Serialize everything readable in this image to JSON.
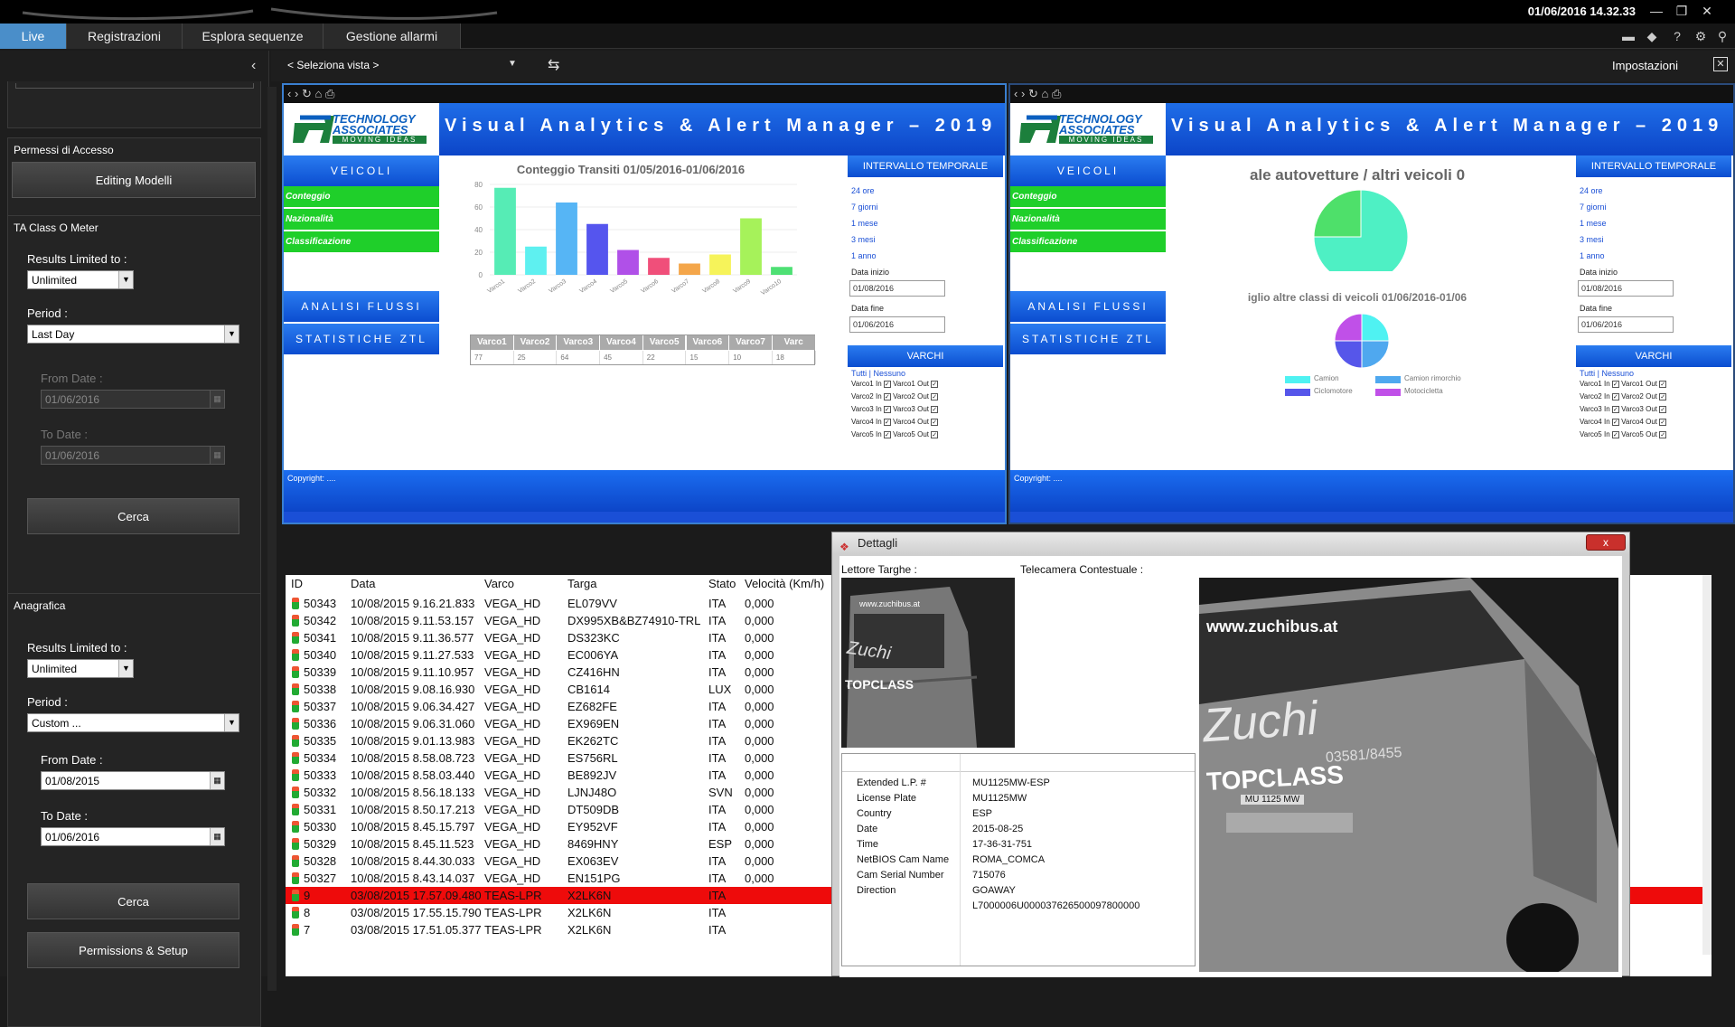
{
  "clock": "01/06/2016 14.32.33",
  "tabs": [
    "Live",
    "Registrazioni",
    "Esplora sequenze",
    "Gestione allarmi"
  ],
  "view_select": "< Seleziona vista >",
  "settings_label": "Impostazioni",
  "sidebar": {
    "access_title": "Permessi di Accesso",
    "editing_btn": "Editing Modelli",
    "meter_title": "TA Class O Meter",
    "results_label": "Results Limited to :",
    "results_value": "Unlimited",
    "period_label": "Period :",
    "period_value": "Last Day",
    "from_label": "From Date :",
    "from_value": "01/06/2016",
    "to_label": "To Date :",
    "to_value": "01/06/2016",
    "search_btn": "Cerca",
    "registry_title": "Anagrafica",
    "results2_label": "Results Limited to :",
    "results2_value": "Unlimited",
    "period2_label": "Period :",
    "period2_value": "Custom ...",
    "from2_label": "From Date :",
    "from2_value": "01/08/2015",
    "to2_label": "To Date :",
    "to2_value": "01/06/2016",
    "search2_btn": "Cerca",
    "perm_btn": "Permissions & Setup"
  },
  "web": {
    "header": "Visual Analytics & Alert Manager – 2019",
    "logo_line1": "TECHNOLOGY",
    "logo_line2": "ASSOCIATES",
    "logo_line3": "MOVING IDEAS",
    "btn_veicoli": "VEICOLI",
    "g1": "Conteggio",
    "g2": "Nazionalità",
    "g3": "Classificazione",
    "btn_flussi": "ANALISI FLUSSI",
    "btn_ztl": "STATISTICHE ZTL",
    "interval": "INTERVALLO TEMPORALE",
    "links": [
      "24 ore",
      "7 giorni",
      "1 mese",
      "3 mesi",
      "1 anno"
    ],
    "start_label": "Data inizio",
    "start_value": "01/08/2016",
    "end_label": "Data fine",
    "end_value": "01/06/2016",
    "varchi": "VARCHI",
    "tutti": "Tutti | Nessuno",
    "gates": [
      "Varco1",
      "Varco2",
      "Varco3",
      "Varco4",
      "Varco5"
    ],
    "in": "In",
    "out": "Out",
    "copyright": "Copyright: ....",
    "pane2_title1": "ale autovetture / altri veicoli 0",
    "pane2_title2": "iglio altre classi di veicoli 01/06/2016-01/06",
    "legend": [
      "Camion",
      "Camion rimorchio",
      "Ciclomotore",
      "Motocicletta"
    ]
  },
  "chart_data": [
    {
      "type": "bar",
      "title": "Conteggio Transiti 01/05/2016-01/06/2016",
      "categories": [
        "Varco1",
        "Varco2",
        "Varco3",
        "Varco4",
        "Varco5",
        "Varco6",
        "Varco7",
        "Varco8",
        "Varco9",
        "Varco10"
      ],
      "values": [
        77,
        25,
        64,
        45,
        22,
        15,
        10,
        18,
        50,
        7
      ],
      "ylim": [
        0,
        80
      ],
      "yticks": [
        0,
        20,
        40,
        60,
        80
      ],
      "colors": [
        "#56ecb5",
        "#5ef0f0",
        "#56b5f5",
        "#5555ee",
        "#b050e8",
        "#f04f7a",
        "#f4a64a",
        "#f6f35a",
        "#a6f25a",
        "#4ee074"
      ]
    },
    {
      "type": "table",
      "headers": [
        "Varco1",
        "Varco2",
        "Varco3",
        "Varco4",
        "Varco5",
        "Varco6",
        "Varco7",
        "Varc"
      ],
      "values": [
        "77",
        "25",
        "64",
        "45",
        "22",
        "15",
        "10",
        "18"
      ]
    },
    {
      "type": "pie",
      "title": "ale autovetture / altri veicoli 0",
      "values": [
        75,
        25
      ],
      "colors": [
        "#4ef0c4",
        "#4ee06a"
      ]
    },
    {
      "type": "pie",
      "title": "iglio altre classi di veicoli 01/06/2016-01/06",
      "categories": [
        "Camion",
        "Camion rimorchio",
        "Ciclomotore",
        "Motocicletta"
      ],
      "values": [
        25,
        25,
        25,
        25
      ],
      "colors": [
        "#4ff2f2",
        "#4fa8ef",
        "#5656ea",
        "#c050e8"
      ]
    }
  ],
  "grid": {
    "headers": [
      "ID",
      "Data",
      "Varco",
      "Targa",
      "Stato",
      "Velocità (Km/h)"
    ],
    "rows": [
      [
        "50343",
        "10/08/2015 9.16.21.833",
        "VEGA_HD",
        "EL079VV",
        "ITA",
        "0,000"
      ],
      [
        "50342",
        "10/08/2015 9.11.53.157",
        "VEGA_HD",
        "DX995XB&BZ74910-TRL",
        "ITA",
        "0,000"
      ],
      [
        "50341",
        "10/08/2015 9.11.36.577",
        "VEGA_HD",
        "DS323KC",
        "ITA",
        "0,000"
      ],
      [
        "50340",
        "10/08/2015 9.11.27.533",
        "VEGA_HD",
        "EC006YA",
        "ITA",
        "0,000"
      ],
      [
        "50339",
        "10/08/2015 9.11.10.957",
        "VEGA_HD",
        "CZ416HN",
        "ITA",
        "0,000"
      ],
      [
        "50338",
        "10/08/2015 9.08.16.930",
        "VEGA_HD",
        "CB1614",
        "LUX",
        "0,000"
      ],
      [
        "50337",
        "10/08/2015 9.06.34.427",
        "VEGA_HD",
        "EZ682FE",
        "ITA",
        "0,000"
      ],
      [
        "50336",
        "10/08/2015 9.06.31.060",
        "VEGA_HD",
        "EX969EN",
        "ITA",
        "0,000"
      ],
      [
        "50335",
        "10/08/2015 9.01.13.983",
        "VEGA_HD",
        "EK262TC",
        "ITA",
        "0,000"
      ],
      [
        "50334",
        "10/08/2015 8.58.08.723",
        "VEGA_HD",
        "ES756RL",
        "ITA",
        "0,000"
      ],
      [
        "50333",
        "10/08/2015 8.58.03.440",
        "VEGA_HD",
        "BE892JV",
        "ITA",
        "0,000"
      ],
      [
        "50332",
        "10/08/2015 8.56.18.133",
        "VEGA_HD",
        "LJNJ48O",
        "SVN",
        "0,000"
      ],
      [
        "50331",
        "10/08/2015 8.50.17.213",
        "VEGA_HD",
        "DT509DB",
        "ITA",
        "0,000"
      ],
      [
        "50330",
        "10/08/2015 8.45.15.797",
        "VEGA_HD",
        "EY952VF",
        "ITA",
        "0,000"
      ],
      [
        "50329",
        "10/08/2015 8.45.11.523",
        "VEGA_HD",
        "8469HNY",
        "ESP",
        "0,000"
      ],
      [
        "50328",
        "10/08/2015 8.44.30.033",
        "VEGA_HD",
        "EX063EV",
        "ITA",
        "0,000"
      ],
      [
        "50327",
        "10/08/2015 8.43.14.037",
        "VEGA_HD",
        "EN151PG",
        "ITA",
        "0,000"
      ],
      [
        "9",
        "03/08/2015 17.57.09.480",
        "TEAS-LPR",
        "X2LK6N",
        "ITA",
        ""
      ],
      [
        "8",
        "03/08/2015 17.55.15.790",
        "TEAS-LPR",
        "X2LK6N",
        "ITA",
        ""
      ],
      [
        "7",
        "03/08/2015 17.51.05.377",
        "TEAS-LPR",
        "X2LK6N",
        "ITA",
        ""
      ]
    ]
  },
  "dialog": {
    "title": "Dettagli",
    "bg_title": "",
    "close": "x",
    "reader_label": "Lettore Targhe :",
    "camera_label": "Telecamera Contestuale :",
    "bus_site": "www.zuchibus.at",
    "bus_brand": "TOPCLASS",
    "bus_name": "Zuchi",
    "bus_phone": "03581/8455",
    "bus_plate": "MU 1125 MW",
    "props": [
      [
        "Extended L.P. #",
        "MU1125MW-ESP"
      ],
      [
        "License Plate",
        "MU1125MW"
      ],
      [
        "Country",
        "ESP"
      ],
      [
        "Date",
        "2015-08-25"
      ],
      [
        "Time",
        "17-36-31-751"
      ],
      [
        "NetBIOS Cam Name",
        "ROMA_COMCA"
      ],
      [
        "Cam Serial Number",
        "715076"
      ],
      [
        "Direction",
        "GOAWAY"
      ],
      [
        "",
        "L7000006U000037626500097800000"
      ]
    ]
  }
}
